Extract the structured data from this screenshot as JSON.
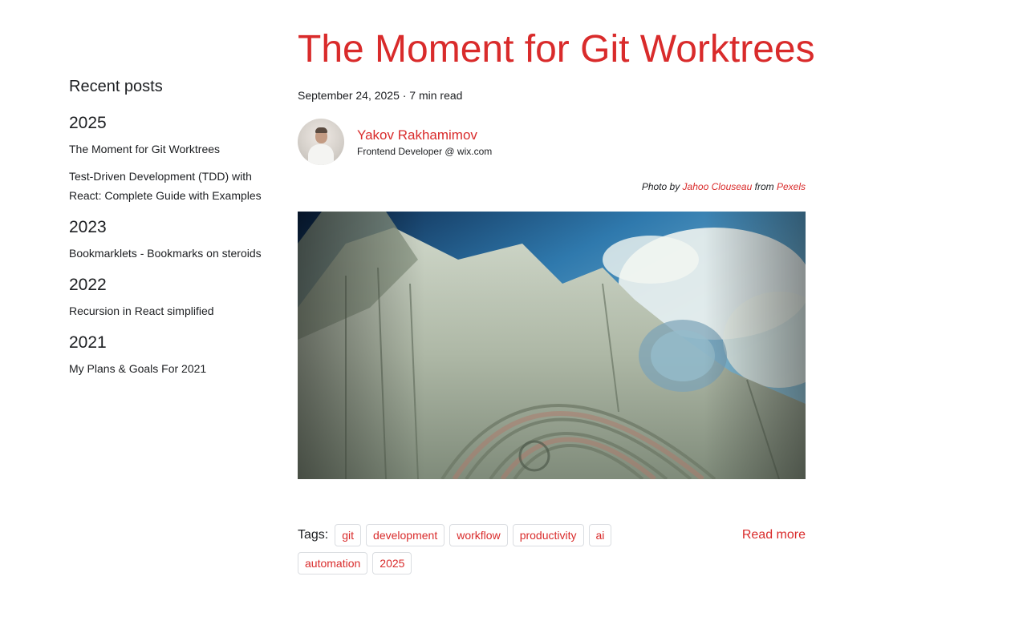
{
  "sidebar": {
    "title": "Recent posts",
    "groups": [
      {
        "year": "2025",
        "posts": [
          "The Moment for Git Worktrees",
          "Test-Driven Development (TDD) with React: Complete Guide with Examples"
        ]
      },
      {
        "year": "2023",
        "posts": [
          "Bookmarklets - Bookmarks on steroids"
        ]
      },
      {
        "year": "2022",
        "posts": [
          "Recursion in React simplified"
        ]
      },
      {
        "year": "2021",
        "posts": [
          "My Plans & Goals For 2021"
        ]
      }
    ]
  },
  "post": {
    "title": "The Moment for Git Worktrees",
    "meta": "September 24, 2025 · 7 min read",
    "author": {
      "name": "Yakov Rakhamimov",
      "role": "Frontend Developer @ wix.com"
    },
    "credit": {
      "prefix": "Photo by",
      "photographer": "Jahoo Clouseau",
      "middle": "from",
      "source": "Pexels"
    },
    "tags_label": "Tags:",
    "tags": [
      "git",
      "development",
      "workflow",
      "productivity",
      "ai",
      "automation",
      "2025"
    ],
    "read_more": "Read more"
  },
  "colors": {
    "accent": "#d92b2b",
    "text": "#1c1e21",
    "tag_border": "#dadde1"
  }
}
